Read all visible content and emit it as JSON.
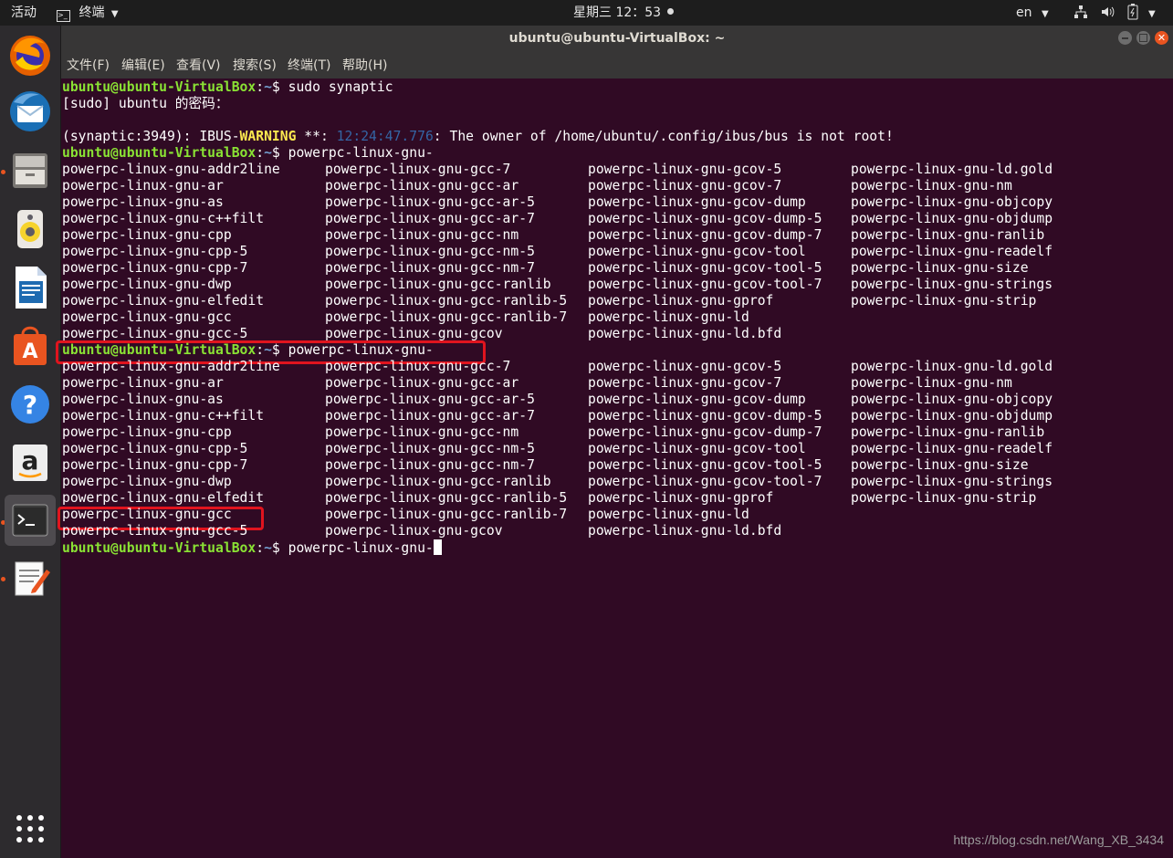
{
  "topbar": {
    "activities": "活动",
    "app_name": "终端",
    "clock": "星期三 12：53",
    "language": "en"
  },
  "window": {
    "title": "ubuntu@ubuntu-VirtualBox: ~"
  },
  "menu": [
    "文件(F)",
    "编辑(E)",
    "查看(V)",
    "搜索(S)",
    "终端(T)",
    "帮助(H)"
  ],
  "terminal": {
    "prompt_user": "ubuntu@ubuntu-VirtualBox",
    "prompt_path": "~",
    "prompt_symbol": "$ ",
    "cmd1": "sudo synaptic",
    "sudo_prompt": "[sudo] ubuntu 的密码：",
    "warning": {
      "prefix": "(synaptic:3949): IBUS-",
      "level": "WARNING",
      "sep": " **: ",
      "time": "12:24:47.776",
      "message": ": The owner of /home/ubuntu/.config/ibus/bus is not root!"
    },
    "cmd2": "powerpc-linux-gnu-",
    "completion_rows": [
      [
        "powerpc-linux-gnu-addr2line",
        "powerpc-linux-gnu-gcc-7",
        "powerpc-linux-gnu-gcov-5",
        "powerpc-linux-gnu-ld.gold"
      ],
      [
        "powerpc-linux-gnu-ar",
        "powerpc-linux-gnu-gcc-ar",
        "powerpc-linux-gnu-gcov-7",
        "powerpc-linux-gnu-nm"
      ],
      [
        "powerpc-linux-gnu-as",
        "powerpc-linux-gnu-gcc-ar-5",
        "powerpc-linux-gnu-gcov-dump",
        "powerpc-linux-gnu-objcopy"
      ],
      [
        "powerpc-linux-gnu-c++filt",
        "powerpc-linux-gnu-gcc-ar-7",
        "powerpc-linux-gnu-gcov-dump-5",
        "powerpc-linux-gnu-objdump"
      ],
      [
        "powerpc-linux-gnu-cpp",
        "powerpc-linux-gnu-gcc-nm",
        "powerpc-linux-gnu-gcov-dump-7",
        "powerpc-linux-gnu-ranlib"
      ],
      [
        "powerpc-linux-gnu-cpp-5",
        "powerpc-linux-gnu-gcc-nm-5",
        "powerpc-linux-gnu-gcov-tool",
        "powerpc-linux-gnu-readelf"
      ],
      [
        "powerpc-linux-gnu-cpp-7",
        "powerpc-linux-gnu-gcc-nm-7",
        "powerpc-linux-gnu-gcov-tool-5",
        "powerpc-linux-gnu-size"
      ],
      [
        "powerpc-linux-gnu-dwp",
        "powerpc-linux-gnu-gcc-ranlib",
        "powerpc-linux-gnu-gcov-tool-7",
        "powerpc-linux-gnu-strings"
      ],
      [
        "powerpc-linux-gnu-elfedit",
        "powerpc-linux-gnu-gcc-ranlib-5",
        "powerpc-linux-gnu-gprof",
        "powerpc-linux-gnu-strip"
      ],
      [
        "powerpc-linux-gnu-gcc",
        "powerpc-linux-gnu-gcc-ranlib-7",
        "powerpc-linux-gnu-ld",
        ""
      ],
      [
        "powerpc-linux-gnu-gcc-5",
        "powerpc-linux-gnu-gcov",
        "powerpc-linux-gnu-ld.bfd",
        ""
      ]
    ]
  },
  "dock": [
    "firefox-icon",
    "thunderbird-icon",
    "files-icon",
    "rhythmbox-icon",
    "writer-icon",
    "software-center-icon",
    "help-icon",
    "amazon-icon",
    "terminal-icon",
    "text-editor-icon",
    "show-apps-icon"
  ],
  "watermark": "https://blog.csdn.net/Wang_XB_3434",
  "colors": {
    "terminal_bg": "#300a24",
    "prompt_green": "#8ae234",
    "prompt_blue": "#729fcf",
    "highlight_red": "#e0141e",
    "accent": "#e95420"
  }
}
